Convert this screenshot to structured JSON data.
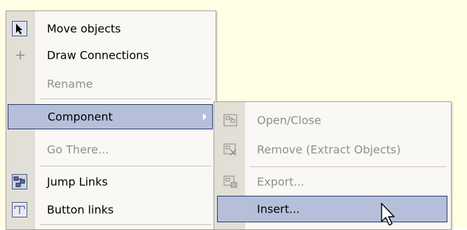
{
  "context_menu": {
    "items": [
      {
        "label": "Move objects",
        "icon": "arrow-cursor-icon",
        "enabled": true
      },
      {
        "label": "Draw Connections",
        "icon": "plus-crosshair-icon",
        "enabled": true
      },
      {
        "label": "Rename",
        "icon": "",
        "enabled": false
      },
      {
        "label": "Component",
        "icon": "",
        "enabled": true,
        "has_submenu": true,
        "highlighted": true
      },
      {
        "label": "Go There...",
        "icon": "",
        "enabled": false
      },
      {
        "label": "Jump Links",
        "icon": "jump-links-icon",
        "enabled": true
      },
      {
        "label": "Button links",
        "icon": "button-links-icon",
        "enabled": true
      }
    ]
  },
  "submenu": {
    "items": [
      {
        "label": "Open/Close",
        "icon": "open-close-component-icon",
        "enabled": false
      },
      {
        "label": "Remove (Extract Objects)",
        "icon": "remove-component-icon",
        "enabled": false
      },
      {
        "label": "Export...",
        "icon": "export-component-icon",
        "enabled": false
      },
      {
        "label": "Insert...",
        "icon": "",
        "enabled": true,
        "highlighted": true
      }
    ]
  },
  "colors": {
    "canvas_background": "#fffde3",
    "menu_background": "#f9f8f5",
    "menu_gutter": "#e2dfd6",
    "highlight_fill": "#b5bfd9",
    "highlight_border": "#2a3a6c",
    "disabled_text": "#8f8f8f"
  }
}
